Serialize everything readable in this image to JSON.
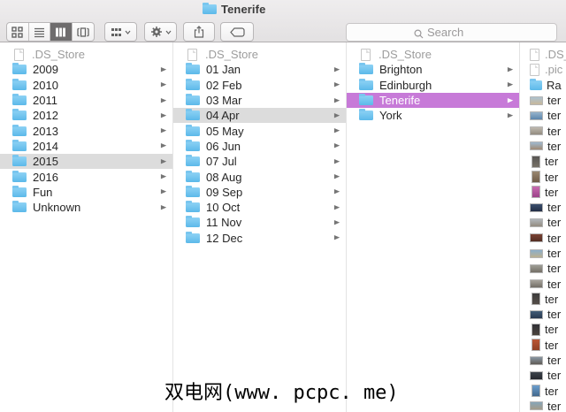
{
  "window": {
    "title": "Tenerife"
  },
  "toolbar": {
    "search_placeholder": "Search",
    "view_buttons": [
      {
        "id": "icon-view",
        "selected": false
      },
      {
        "id": "list-view",
        "selected": false
      },
      {
        "id": "column-view",
        "selected": true
      },
      {
        "id": "coverflow-view",
        "selected": false
      }
    ]
  },
  "colors": {
    "selection_gray": "#dcdcdc",
    "selection_purple": "#c77ad8",
    "folder_blue": "#6ec6f0",
    "toolbar_top": "#efedee",
    "toolbar_bottom": "#e3e1e2"
  },
  "watermark": {
    "text": "双电网(www. pcpc. me)"
  },
  "columns": [
    {
      "tight": false,
      "items": [
        {
          "label": ".DS_Store",
          "type": "file",
          "muted": true
        },
        {
          "label": "2009",
          "type": "folder",
          "arrow": true
        },
        {
          "label": "2010",
          "type": "folder",
          "arrow": true
        },
        {
          "label": "2011",
          "type": "folder",
          "arrow": true
        },
        {
          "label": "2012",
          "type": "folder",
          "arrow": true
        },
        {
          "label": "2013",
          "type": "folder",
          "arrow": true
        },
        {
          "label": "2014",
          "type": "folder",
          "arrow": true
        },
        {
          "label": "2015",
          "type": "folder",
          "arrow": true,
          "selected": "gray"
        },
        {
          "label": "2016",
          "type": "folder",
          "arrow": true
        },
        {
          "label": "Fun",
          "type": "folder",
          "arrow": true
        },
        {
          "label": "Unknown",
          "type": "folder",
          "arrow": true
        }
      ]
    },
    {
      "tight": false,
      "items": [
        {
          "label": ".DS_Store",
          "type": "file",
          "muted": true
        },
        {
          "label": "01 Jan",
          "type": "folder",
          "arrow": true
        },
        {
          "label": "02 Feb",
          "type": "folder",
          "arrow": true
        },
        {
          "label": "03 Mar",
          "type": "folder",
          "arrow": true
        },
        {
          "label": "04 Apr",
          "type": "folder",
          "arrow": true,
          "selected": "gray"
        },
        {
          "label": "05 May",
          "type": "folder",
          "arrow": true
        },
        {
          "label": "06 Jun",
          "type": "folder",
          "arrow": true
        },
        {
          "label": "07 Jul",
          "type": "folder",
          "arrow": true
        },
        {
          "label": "08 Aug",
          "type": "folder",
          "arrow": true
        },
        {
          "label": "09 Sep",
          "type": "folder",
          "arrow": true
        },
        {
          "label": "10 Oct",
          "type": "folder",
          "arrow": true
        },
        {
          "label": "11 Nov",
          "type": "folder",
          "arrow": true
        },
        {
          "label": "12 Dec",
          "type": "folder",
          "arrow": true
        }
      ]
    },
    {
      "tight": false,
      "items": [
        {
          "label": ".DS_Store",
          "type": "file",
          "muted": true
        },
        {
          "label": "Brighton",
          "type": "folder",
          "arrow": true
        },
        {
          "label": "Edinburgh",
          "type": "folder",
          "arrow": true
        },
        {
          "label": "Tenerife",
          "type": "folder",
          "arrow": true,
          "selected": "purple"
        },
        {
          "label": "York",
          "type": "folder",
          "arrow": true
        }
      ]
    },
    {
      "tight": true,
      "items": [
        {
          "label": ".DS_Store",
          "type": "file",
          "muted": true
        },
        {
          "label": ".pic",
          "type": "file",
          "muted": true
        },
        {
          "label": "Ra",
          "type": "folder",
          "arrow": true
        },
        {
          "label": "ter",
          "type": "photo",
          "orient": "l",
          "c1": "#a9c3d6",
          "c2": "#cbb694"
        },
        {
          "label": "ter",
          "type": "photo",
          "orient": "l",
          "c1": "#9db9d0",
          "c2": "#5580a8"
        },
        {
          "label": "ter",
          "type": "photo",
          "orient": "l",
          "c1": "#c6c0b6",
          "c2": "#8d867a"
        },
        {
          "label": "ter",
          "type": "photo",
          "orient": "l",
          "c1": "#9fc0dc",
          "c2": "#a08468"
        },
        {
          "label": "ter",
          "type": "photo",
          "orient": "p",
          "c1": "#555352",
          "c2": "#7a7468"
        },
        {
          "label": "ter",
          "type": "photo",
          "orient": "p",
          "c1": "#9c8a74",
          "c2": "#6b5844"
        },
        {
          "label": "ter",
          "type": "photo",
          "orient": "p",
          "c1": "#cc6fb4",
          "c2": "#983f85"
        },
        {
          "label": "ter",
          "type": "photo",
          "orient": "l",
          "c1": "#3d5273",
          "c2": "#1f2a40"
        },
        {
          "label": "ter",
          "type": "photo",
          "orient": "l",
          "c1": "#b5bcc2",
          "c2": "#8f8678"
        },
        {
          "label": "ter",
          "type": "photo",
          "orient": "l",
          "c1": "#7e4434",
          "c2": "#4f2b22"
        },
        {
          "label": "ter",
          "type": "photo",
          "orient": "l",
          "c1": "#84aed2",
          "c2": "#c2b089"
        },
        {
          "label": "ter",
          "type": "photo",
          "orient": "l",
          "c1": "#a3a39b",
          "c2": "#6f6a61"
        },
        {
          "label": "ter",
          "type": "photo",
          "orient": "l",
          "c1": "#aeaaa2",
          "c2": "#6b675f"
        },
        {
          "label": "ter",
          "type": "photo",
          "orient": "p",
          "c1": "#3a3a3a",
          "c2": "#57504a"
        },
        {
          "label": "ter",
          "type": "photo",
          "orient": "l",
          "c1": "#44607c",
          "c2": "#24344a"
        },
        {
          "label": "ter",
          "type": "photo",
          "orient": "p",
          "c1": "#2e2e35",
          "c2": "#4e463e"
        },
        {
          "label": "ter",
          "type": "photo",
          "orient": "p",
          "c1": "#bf5936",
          "c2": "#8c3f24"
        },
        {
          "label": "ter",
          "type": "photo",
          "orient": "l",
          "c1": "#8e9dac",
          "c2": "#5c554d"
        },
        {
          "label": "ter",
          "type": "photo",
          "orient": "l",
          "c1": "#3f474f",
          "c2": "#23242b"
        },
        {
          "label": "ter",
          "type": "photo",
          "orient": "p",
          "c1": "#6fa3d4",
          "c2": "#3f6487"
        },
        {
          "label": "ter",
          "type": "photo",
          "orient": "l",
          "c1": "#83a7c0",
          "c2": "#a89a82"
        }
      ]
    }
  ]
}
